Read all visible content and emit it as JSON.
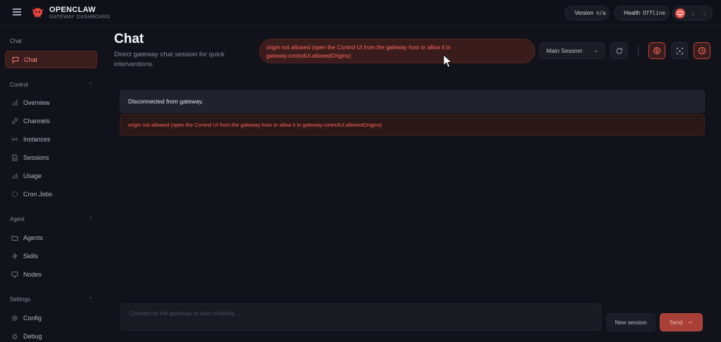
{
  "topbar": {
    "brand_title": "OPENCLAW",
    "brand_subtitle": "GATEWAY DASHBOARD",
    "version_label": "Version",
    "version_value": "n/a",
    "health_label": "Health",
    "health_value": "Offline",
    "colors": {
      "version_dot": "#3ecf6a",
      "health_dot": "#ef4f48",
      "accent": "#e9574e"
    }
  },
  "sidebar": {
    "sections": [
      {
        "label": "Chat",
        "items": [
          {
            "label": "Chat",
            "icon": "message-square-icon",
            "active": true
          }
        ]
      },
      {
        "label": "Control",
        "items": [
          {
            "label": "Overview",
            "icon": "bar-chart-icon"
          },
          {
            "label": "Channels",
            "icon": "link-icon"
          },
          {
            "label": "Instances",
            "icon": "radio-icon"
          },
          {
            "label": "Sessions",
            "icon": "file-text-icon"
          },
          {
            "label": "Usage",
            "icon": "bar-chart-icon"
          },
          {
            "label": "Cron Jobs",
            "icon": "loader-icon"
          }
        ]
      },
      {
        "label": "Agent",
        "items": [
          {
            "label": "Agents",
            "icon": "folder-icon"
          },
          {
            "label": "Skills",
            "icon": "zap-icon"
          },
          {
            "label": "Nodes",
            "icon": "monitor-icon"
          }
        ]
      },
      {
        "label": "Settings",
        "items": [
          {
            "label": "Config",
            "icon": "gear-icon"
          },
          {
            "label": "Debug",
            "icon": "bug-icon"
          }
        ]
      }
    ]
  },
  "main": {
    "title": "Chat",
    "subtitle": "Direct gateway chat session for quick interventions.",
    "error_banner": "origin not allowed (open the Control UI from the gateway host or allow it in gateway.controlUi.allowedOrigins)",
    "session_select": "Main Session",
    "status_message": "Disconnected from gateway.",
    "error_message": "origin not allowed (open the Control UI from the gateway host or allow it in gateway.controlUi.allowedOrigins)",
    "composer_placeholder": "Connect to the gateway to start chatting…",
    "new_session_label": "New session",
    "send_label": "Send",
    "send_shortcut": "↵"
  }
}
